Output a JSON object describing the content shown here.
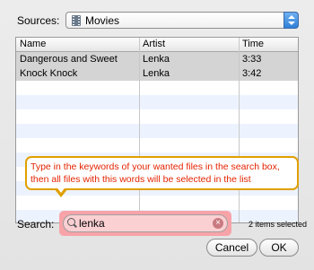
{
  "sources": {
    "label": "Sources:",
    "value": "Movies"
  },
  "table": {
    "columns": [
      "Name",
      "Artist",
      "Time"
    ],
    "rows": [
      {
        "name": "Dangerous and Sweet",
        "artist": "Lenka",
        "time": "3:33",
        "selected": true
      },
      {
        "name": "Knock Knock",
        "artist": "Lenka",
        "time": "3:42",
        "selected": true
      }
    ]
  },
  "tooltip": {
    "line1": "Type in the keywords of your wanted files in the search box,",
    "line2": "then all files with this words will be selected in the list"
  },
  "search": {
    "label": "Search:",
    "value": "lenka",
    "status": "2 items selected"
  },
  "buttons": {
    "cancel": "Cancel",
    "ok": "OK"
  },
  "colors": {
    "selection": "#d4d4d4",
    "tooltip_border": "#e0a000",
    "tooltip_text": "#e52300",
    "search_highlight": "#f7a3a8"
  }
}
